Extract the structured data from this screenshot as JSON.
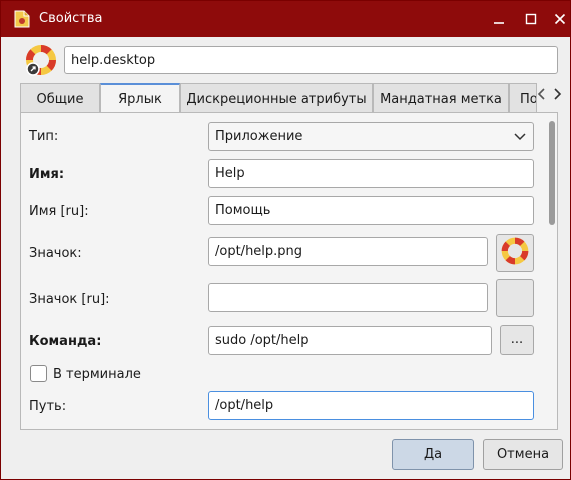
{
  "window": {
    "title": "Свойства",
    "titlebar_color": "#8e0b0b",
    "controls": [
      "minimize-icon",
      "maximize-icon",
      "close-icon"
    ]
  },
  "header": {
    "file_name": "help.desktop",
    "icon": "lifebuoy-icon"
  },
  "tabs": [
    {
      "label": "Общие",
      "active": false
    },
    {
      "label": "Ярлык",
      "active": true
    },
    {
      "label": "Дискреционные атрибуты",
      "active": false
    },
    {
      "label": "Мандатная метка",
      "active": false
    },
    {
      "label": "По",
      "active": false
    }
  ],
  "form": {
    "type": {
      "label": "Тип:",
      "value": "Приложение"
    },
    "name": {
      "label": "Имя:",
      "value": "Help"
    },
    "name_ru": {
      "label": "Имя [ru]:",
      "value": "Помощь"
    },
    "icon": {
      "label": "Значок:",
      "value": "/opt/help.png"
    },
    "icon_ru": {
      "label": "Значок [ru]:",
      "value": ""
    },
    "command": {
      "label": "Команда:",
      "value": "sudo /opt/help",
      "browse_label": "..."
    },
    "in_terminal": {
      "label": "В терминале",
      "checked": false
    },
    "path": {
      "label": "Путь:",
      "value": "/opt/help"
    }
  },
  "buttons": {
    "ok": "Да",
    "cancel": "Отмена"
  }
}
